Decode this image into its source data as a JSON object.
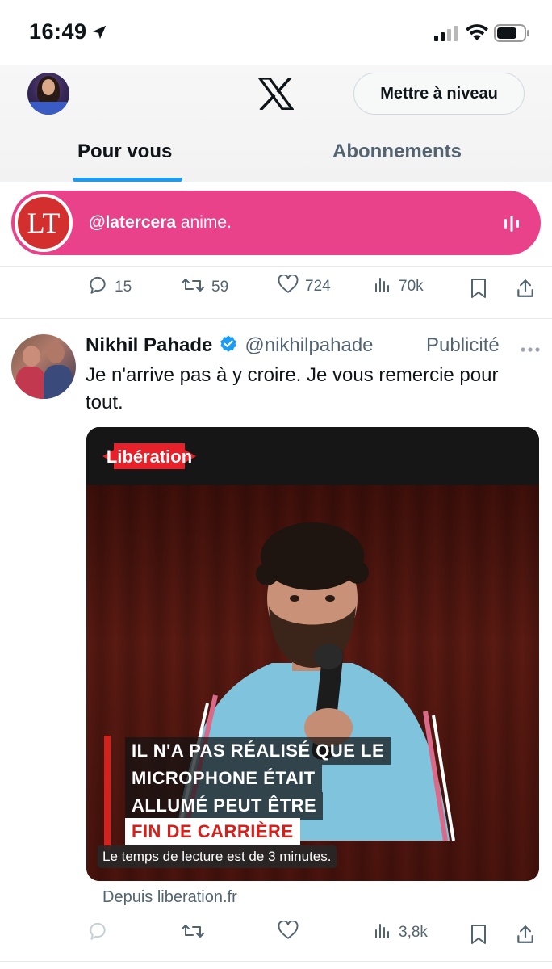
{
  "status_bar": {
    "time": "16:49",
    "icons": [
      "location-arrow-icon",
      "cellular-signal-icon",
      "wifi-icon",
      "battery-icon"
    ]
  },
  "header": {
    "logo": "x-logo-icon",
    "upgrade_label": "Mettre à niveau",
    "tabs": [
      {
        "label": "Pour vous",
        "active": true
      },
      {
        "label": "Abonnements",
        "active": false
      }
    ],
    "accent_color": "#1d9bf0"
  },
  "live_banner": {
    "logo_text": "LT",
    "handle": "@latercera",
    "action": " anime.",
    "color": "#e9428a"
  },
  "previous_tweet_actions": {
    "replies": "15",
    "reposts": "59",
    "likes": "724",
    "views": "70k"
  },
  "tweet": {
    "name": "Nikhil Pahade",
    "handle": "@nikhilpahade",
    "promoted_label": "Publicité",
    "text": "Je n'arrive pas à y croire. Je vous remercie pour tout.",
    "card": {
      "brand": "Libération",
      "caption_lines": [
        "IL N'A PAS RÉALISÉ QUE LE",
        "MICROPHONE ÉTAIT",
        "ALLUMÉ PEUT ÊTRE"
      ],
      "caption_highlight": "FIN DE CARRIÈRE",
      "reading_time": "Le temps de lecture est de 3 minutes.",
      "source": "Depuis liberation.fr"
    },
    "actions": {
      "views": "3,8k"
    }
  }
}
